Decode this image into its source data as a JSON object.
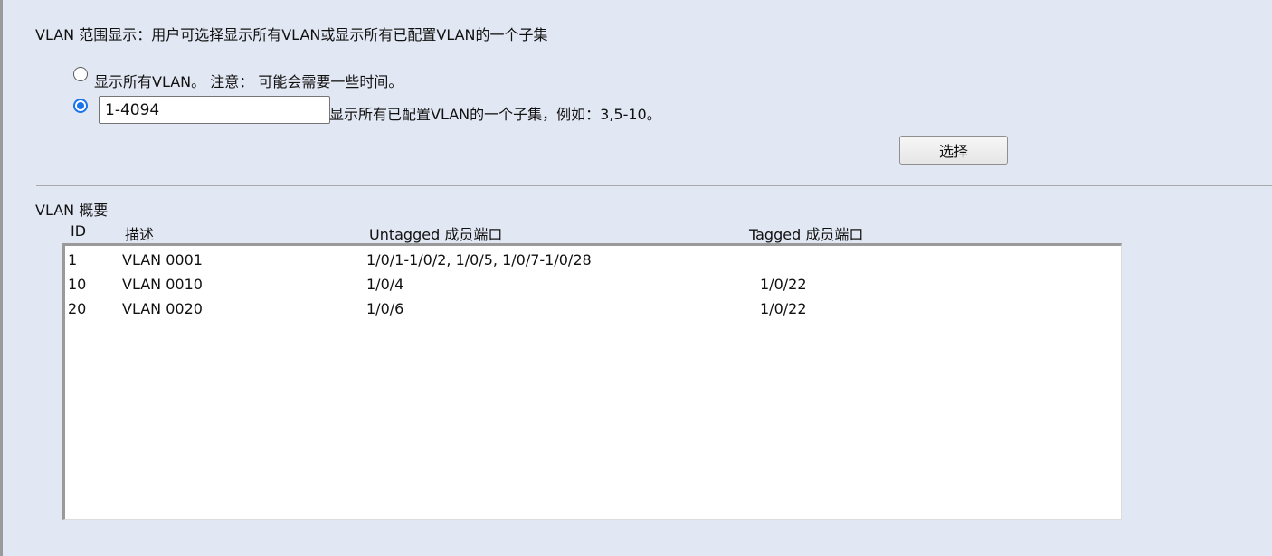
{
  "description": "VLAN 范围显示：用户可选择显示所有VLAN或显示所有已配置VLAN的一个子集",
  "options": {
    "all": {
      "label": "显示所有VLAN。 注意： 可能会需要一些时间。",
      "checked": false
    },
    "subset": {
      "value": "1-4094",
      "hint": "显示所有已配置VLAN的一个子集，例如：3,5-10。",
      "checked": true
    }
  },
  "select_button": "选择",
  "summary": {
    "title": "VLAN 概要",
    "columns": {
      "id": "ID",
      "description": "描述",
      "untagged": "Untagged 成员端口",
      "tagged": "Tagged 成员端口"
    },
    "rows": [
      {
        "id": "1",
        "description": "VLAN 0001",
        "untagged": "1/0/1-1/0/2, 1/0/5, 1/0/7-1/0/28",
        "tagged": ""
      },
      {
        "id": "10",
        "description": "VLAN 0010",
        "untagged": "1/0/4",
        "tagged": "1/0/22"
      },
      {
        "id": "20",
        "description": "VLAN 0020",
        "untagged": "1/0/6",
        "tagged": "1/0/22"
      }
    ]
  },
  "colors": {
    "background": "#e2e8f3",
    "radio_accent": "#1a73e8"
  }
}
